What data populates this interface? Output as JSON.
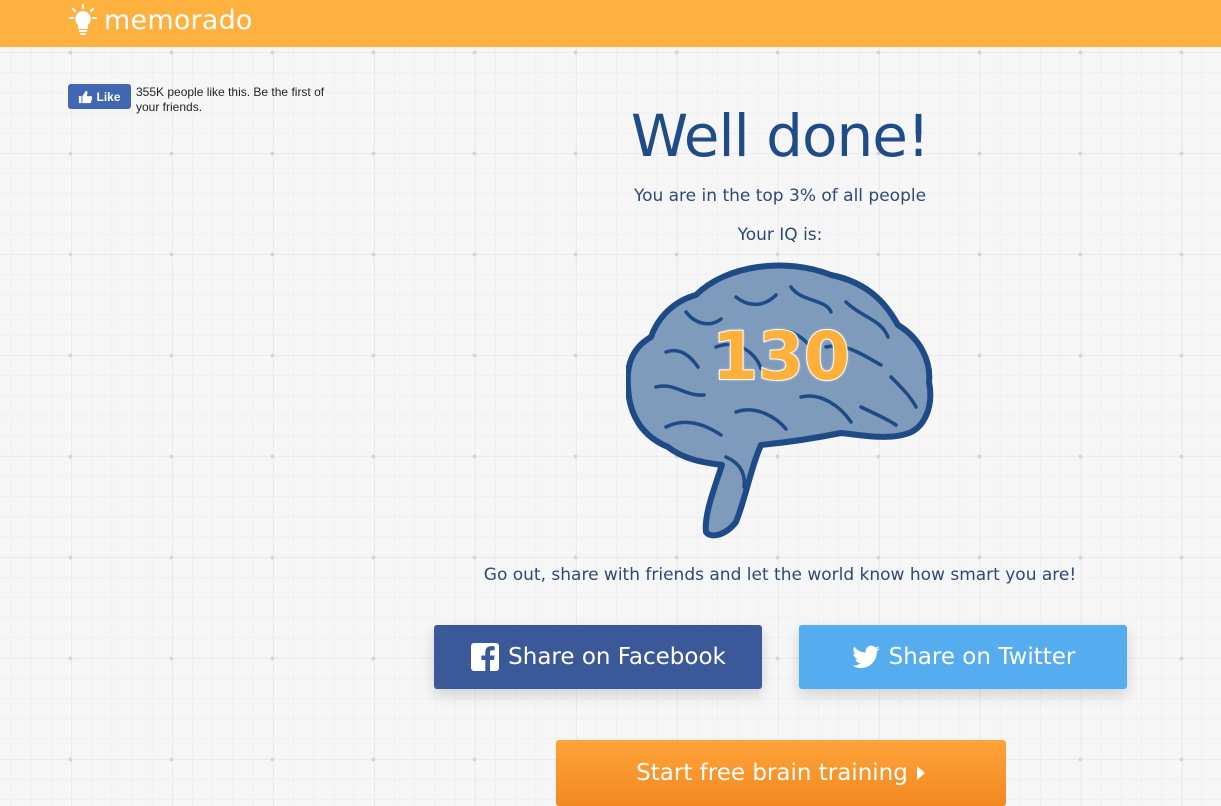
{
  "header": {
    "logo_text": "memorado",
    "background_color": "#feb13f",
    "logo_icon": "lightbulb-icon"
  },
  "fb_like": {
    "button_label": "Like",
    "text": "355K people like this. Be the first of your friends.",
    "button_icon": "thumbs-up-icon"
  },
  "result": {
    "title": "Well done!",
    "subtitle": "You are in the top 3% of all people",
    "iq_label": "Your IQ is:",
    "iq_value": "130",
    "brain_icon": "brain-icon"
  },
  "share": {
    "prompt": "Go out, share with friends and let the world know how smart you are!",
    "facebook_label": "Share on Facebook",
    "twitter_label": "Share on Twitter",
    "facebook_color": "#3b5998",
    "twitter_color": "#55acee"
  },
  "cta": {
    "label": "Start free brain training",
    "color": "#f7941e"
  }
}
